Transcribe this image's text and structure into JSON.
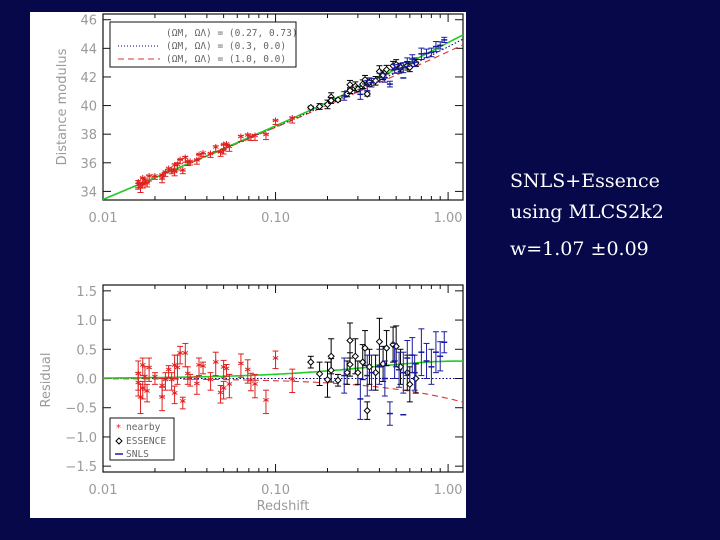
{
  "caption": {
    "line1": "SNLS+Essence",
    "line2": "using MLCS2k2",
    "line3": "w=1.07 ±0.09"
  },
  "chart_data": [
    {
      "type": "scatter",
      "title": "",
      "xlabel": "",
      "ylabel": "Distance modulus",
      "xscale": "log",
      "xlim": [
        0.01,
        1.22
      ],
      "ylim": [
        33.4,
        46.4
      ],
      "xticks": [
        "0.01",
        "0.10",
        "1.00"
      ],
      "yticks": [
        "34",
        "36",
        "38",
        "40",
        "42",
        "44",
        "46"
      ],
      "legend_position": "top-left",
      "models": [
        {
          "label": "(ΩM, ΩΛ) = (0.27, 0.73)",
          "om": 0.27,
          "ol": 0.73,
          "color": "#22cc22",
          "style": "solid"
        },
        {
          "label": "(ΩM, ΩΛ) = (0.3, 0.0)",
          "om": 0.3,
          "ol": 0.0,
          "color": "#000080",
          "style": "dotted"
        },
        {
          "label": "(ΩM, ΩΛ) = (1.0, 0.0)",
          "om": 1.0,
          "ol": 0.0,
          "color": "#dd3333",
          "style": "dashed"
        }
      ]
    },
    {
      "type": "scatter",
      "title": "",
      "xlabel": "Redshift",
      "ylabel": "Residual",
      "xscale": "log",
      "xlim": [
        0.01,
        1.22
      ],
      "ylim": [
        -1.6,
        1.6
      ],
      "xticks": [
        "0.01",
        "0.10",
        "1.00"
      ],
      "yticks": [
        "-1.5",
        "-1.0",
        "-0.5",
        "0.0",
        "0.5",
        "1.0",
        "1.5"
      ],
      "ytick_labels": [
        "−1.5",
        "−1.0",
        "−0.5",
        "0.0",
        "0.5",
        "1.0",
        "1.5"
      ],
      "legend_position": "bottom-left",
      "series": [
        {
          "name": "nearby",
          "marker": "star",
          "color": "#e02020",
          "points": [
            [
              0.016,
              0.05,
              0.25
            ],
            [
              0.016,
              -0.1,
              0.2
            ],
            [
              0.0165,
              -0.35,
              0.25
            ],
            [
              0.017,
              0.2,
              0.15
            ],
            [
              0.017,
              -0.2,
              0.15
            ],
            [
              0.0175,
              0.0,
              0.2
            ],
            [
              0.018,
              -0.25,
              0.15
            ],
            [
              0.0185,
              0.15,
              0.2
            ],
            [
              0.02,
              0.0,
              0.1
            ],
            [
              0.022,
              -0.15,
              0.15
            ],
            [
              0.022,
              -0.35,
              0.2
            ],
            [
              0.023,
              -0.05,
              0.15
            ],
            [
              0.024,
              0.12,
              0.1
            ],
            [
              0.025,
              -0.05,
              0.15
            ],
            [
              0.026,
              0.2,
              0.2
            ],
            [
              0.026,
              -0.28,
              0.15
            ],
            [
              0.027,
              0.15,
              0.25
            ],
            [
              0.028,
              0.4,
              0.15
            ],
            [
              0.029,
              -0.42,
              0.1
            ],
            [
              0.03,
              0.4,
              0.2
            ],
            [
              0.031,
              0.05,
              0.15
            ],
            [
              0.032,
              -0.03,
              0.1
            ],
            [
              0.035,
              -0.12,
              0.15
            ],
            [
              0.036,
              0.2,
              0.15
            ],
            [
              0.038,
              0.18,
              0.1
            ],
            [
              0.042,
              -0.05,
              0.15
            ],
            [
              0.045,
              0.25,
              0.2
            ],
            [
              0.048,
              -0.27,
              0.15
            ],
            [
              0.05,
              -0.2,
              0.15
            ],
            [
              0.05,
              0.16,
              0.15
            ],
            [
              0.052,
              0.14,
              0.1
            ],
            [
              0.054,
              -0.13,
              0.2
            ],
            [
              0.063,
              0.22,
              0.2
            ],
            [
              0.069,
              0.12,
              0.2
            ],
            [
              0.072,
              -0.06,
              0.15
            ],
            [
              0.076,
              -0.13,
              0.2
            ],
            [
              0.088,
              -0.4,
              0.2
            ],
            [
              0.1,
              0.32,
              0.15
            ],
            [
              0.125,
              -0.04,
              0.2
            ]
          ]
        },
        {
          "name": "ESSENCE",
          "marker": "diamond",
          "color": "#000000",
          "points": [
            [
              0.16,
              0.28,
              0.1
            ],
            [
              0.18,
              0.08,
              0.2
            ],
            [
              0.2,
              -0.02,
              0.3
            ],
            [
              0.21,
              0.38,
              0.3
            ],
            [
              0.21,
              0.14,
              0.2
            ],
            [
              0.23,
              -0.03,
              0.1
            ],
            [
              0.26,
              0.1,
              0.2
            ],
            [
              0.27,
              0.65,
              0.3
            ],
            [
              0.27,
              0.24,
              0.2
            ],
            [
              0.29,
              0.38,
              0.3
            ],
            [
              0.3,
              0.1,
              0.2
            ],
            [
              0.32,
              0.28,
              0.3
            ],
            [
              0.33,
              0.52,
              0.3
            ],
            [
              0.34,
              -0.55,
              0.15
            ],
            [
              0.35,
              0.2,
              0.3
            ],
            [
              0.38,
              0.1,
              0.3
            ],
            [
              0.4,
              0.63,
              0.4
            ],
            [
              0.42,
              0.25,
              0.3
            ],
            [
              0.44,
              0.52,
              0.3
            ],
            [
              0.48,
              0.58,
              0.3
            ],
            [
              0.5,
              0.55,
              0.35
            ],
            [
              0.53,
              0.2,
              0.3
            ],
            [
              0.58,
              0.1,
              0.3
            ],
            [
              0.6,
              -0.1,
              0.3
            ],
            [
              0.65,
              0.0,
              0.25
            ]
          ]
        },
        {
          "name": "SNLS",
          "marker": "dash",
          "color": "#1a1aa0",
          "points": [
            [
              0.25,
              0.05,
              0.3
            ],
            [
              0.31,
              -0.35,
              0.35
            ],
            [
              0.34,
              0.05,
              0.35
            ],
            [
              0.36,
              0.1,
              0.3
            ],
            [
              0.4,
              0.2,
              0.3
            ],
            [
              0.43,
              0.0,
              0.3
            ],
            [
              0.46,
              -0.6,
              0.2
            ],
            [
              0.49,
              0.3,
              0.3
            ],
            [
              0.52,
              0.15,
              0.3
            ],
            [
              0.55,
              0.1,
              0.35
            ],
            [
              0.58,
              0.35,
              0.3
            ],
            [
              0.62,
              0.4,
              0.3
            ],
            [
              0.64,
              0.1,
              0.3
            ],
            [
              0.7,
              0.45,
              0.4
            ],
            [
              0.75,
              0.3,
              0.3
            ],
            [
              0.8,
              0.2,
              0.3
            ],
            [
              0.85,
              0.45,
              0.35
            ],
            [
              0.9,
              0.38,
              0.25
            ],
            [
              0.95,
              0.62,
              0.18
            ],
            [
              0.55,
              -0.62,
              0.0
            ]
          ]
        }
      ]
    }
  ]
}
